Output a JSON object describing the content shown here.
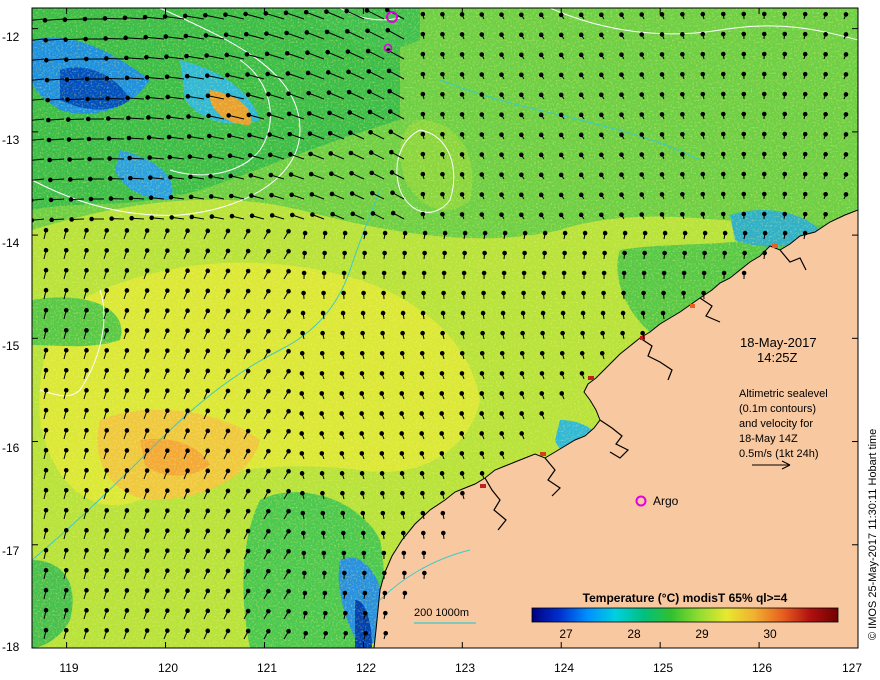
{
  "map": {
    "date_line": "18-May-2017",
    "time_line": "14:25Z",
    "note_lines": [
      "Altimetric sealevel",
      "(0.1m contours)",
      "and velocity for",
      "18-May 14Z",
      "0.5m/s (1kt 24h)"
    ],
    "argo_label": "Argo",
    "depth_label": "200  1000m",
    "credit": "© IMOS 25-May-2017 11:30:11 Hobart time",
    "x_ticks": [
      "119",
      "120",
      "121",
      "122",
      "123",
      "124",
      "125",
      "126",
      "127"
    ],
    "y_ticks": [
      "-12",
      "-13",
      "-14",
      "-15",
      "-16",
      "-17",
      "-18"
    ],
    "lon_range": [
      118.65,
      127
    ],
    "lat_range": [
      -18,
      -11.8
    ]
  },
  "colorbar": {
    "title": "Temperature (°C) modisT 65% ql>=4",
    "tick_values": [
      "27",
      "28",
      "29",
      "30"
    ],
    "range": [
      26.5,
      31
    ],
    "colors": [
      "#000080",
      "#0030d0",
      "#0090ff",
      "#00d0e0",
      "#00c080",
      "#30c030",
      "#90dc30",
      "#e8e830",
      "#f0b030",
      "#e86020",
      "#b01010",
      "#700000"
    ]
  },
  "colors": {
    "land": "#f8c8a0",
    "coast": "#000000",
    "contour_ssh": "#ffffff",
    "contour_depth": "#40c8c8",
    "argo": "#e000e0"
  }
}
